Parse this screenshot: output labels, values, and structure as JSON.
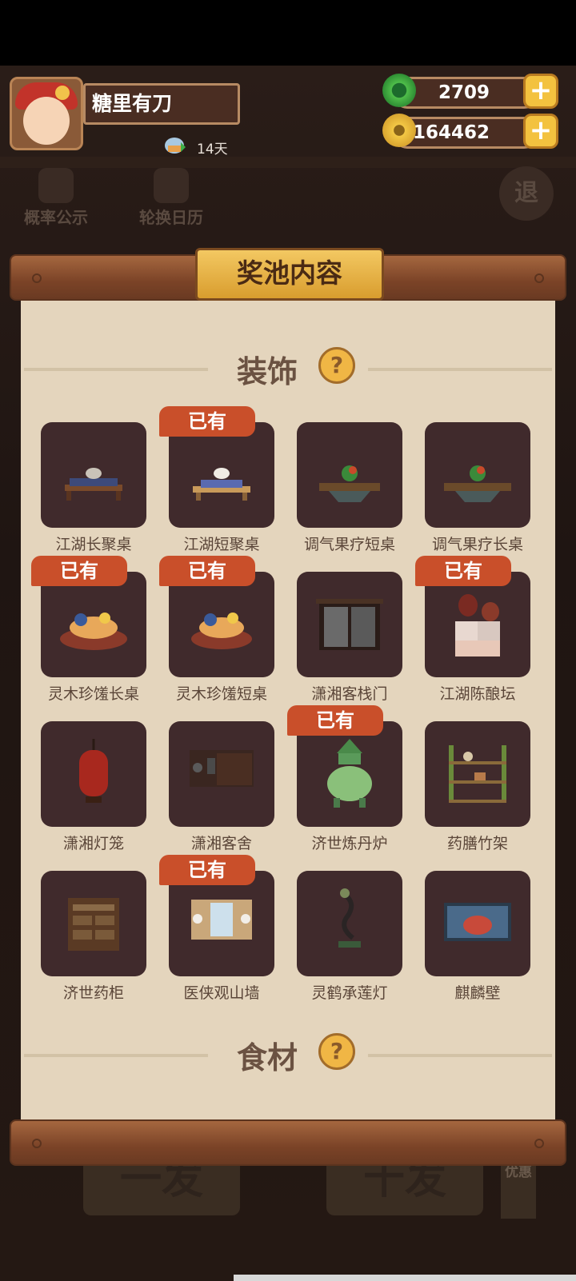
{
  "player": {
    "name": "糖里有刀",
    "days": "14天"
  },
  "resources": {
    "jade": "2709",
    "coins": "164462",
    "plus": "+"
  },
  "background": {
    "probability": "概率公示",
    "calendar": "轮换日历",
    "retreat": "退",
    "single_draw": "一发",
    "ten_draw": "十发",
    "discount": "九折优惠"
  },
  "panel": {
    "title": "奖池内容",
    "help": "?",
    "owned_label": "已有",
    "sections": [
      {
        "title": "装饰"
      },
      {
        "title": "食材"
      }
    ],
    "items": [
      {
        "name": "江湖长聚桌",
        "owned": false
      },
      {
        "name": "江湖短聚桌",
        "owned": true
      },
      {
        "name": "调气果疗短桌",
        "owned": false
      },
      {
        "name": "调气果疗长桌",
        "owned": false
      },
      {
        "name": "灵木珍馐长桌",
        "owned": true
      },
      {
        "name": "灵木珍馐短桌",
        "owned": true
      },
      {
        "name": "潇湘客栈门",
        "owned": false
      },
      {
        "name": "江湖陈酿坛",
        "owned": true
      },
      {
        "name": "潇湘灯笼",
        "owned": false
      },
      {
        "name": "潇湘客舍",
        "owned": false
      },
      {
        "name": "济世炼丹炉",
        "owned": true
      },
      {
        "name": "药膳竹架",
        "owned": false
      },
      {
        "name": "济世药柜",
        "owned": false
      },
      {
        "name": "医侠观山墙",
        "owned": true
      },
      {
        "name": "灵鹤承莲灯",
        "owned": false
      },
      {
        "name": "麒麟壁",
        "owned": false
      }
    ]
  },
  "colors": {
    "tile": "#402a2c",
    "paper": "#e4d5bd",
    "owned_badge": "#c94f2a",
    "gold": "#f3c23f"
  }
}
